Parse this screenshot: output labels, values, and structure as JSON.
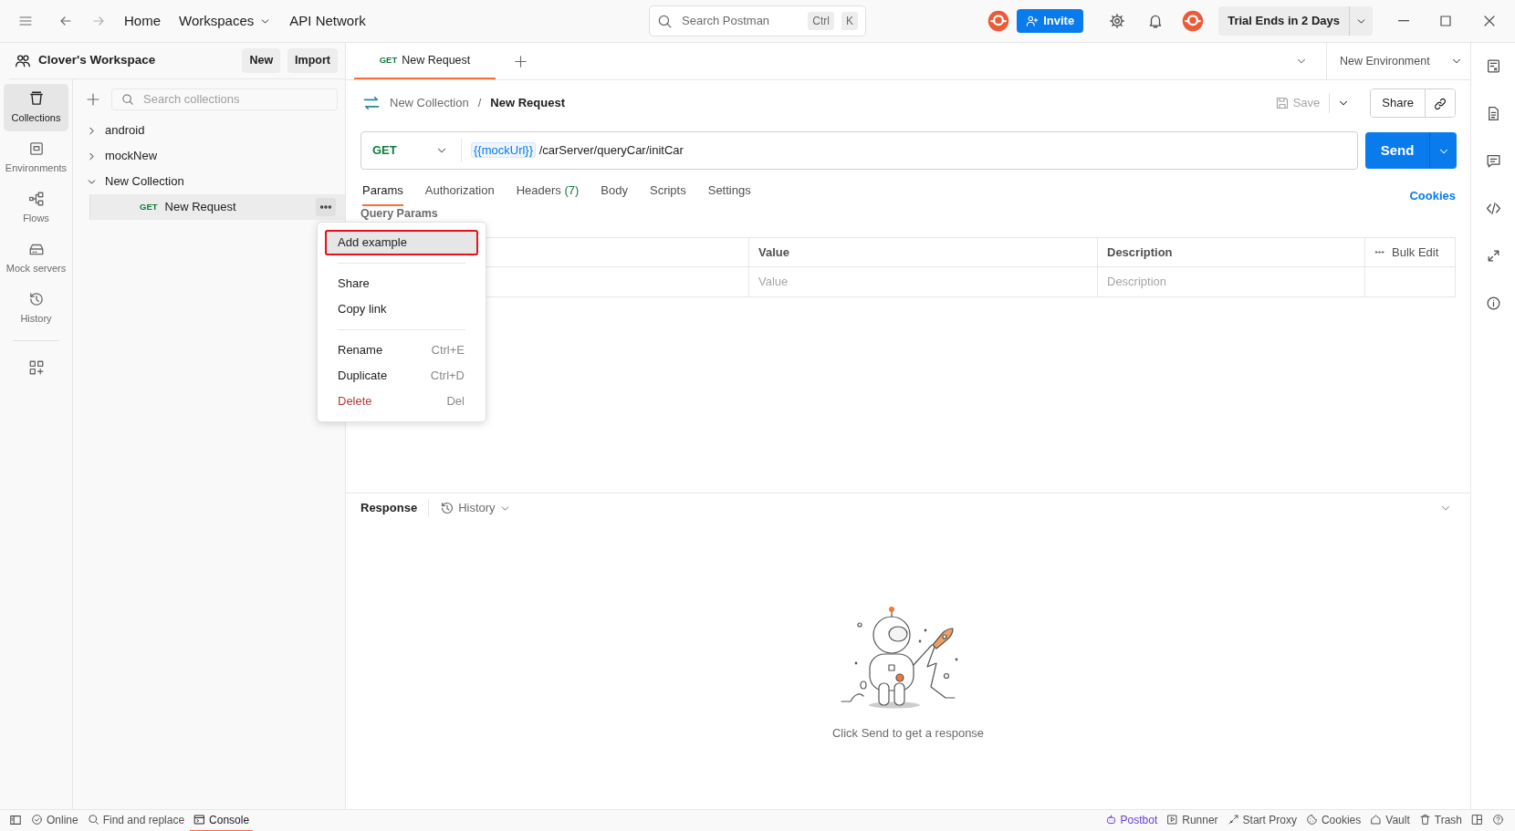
{
  "top_bar": {
    "nav": [
      {
        "label": "Home",
        "dropdown": false
      },
      {
        "label": "Workspaces",
        "dropdown": true
      },
      {
        "label": "API Network",
        "dropdown": false
      }
    ],
    "search": {
      "placeholder": "Search Postman",
      "keys": [
        "Ctrl",
        "K"
      ]
    },
    "invite": "Invite",
    "trial": "Trial Ends in 2 Days"
  },
  "workspace": {
    "name": "Clover's Workspace",
    "buttons": [
      "New",
      "Import"
    ]
  },
  "rail": [
    {
      "label": "Collections",
      "selected": true
    },
    {
      "label": "Environments",
      "selected": false
    },
    {
      "label": "Flows",
      "selected": false
    },
    {
      "label": "Mock servers",
      "selected": false
    },
    {
      "label": "History",
      "selected": false
    }
  ],
  "collections": {
    "search_placeholder": "Search collections",
    "tree": [
      {
        "label": "android",
        "expanded": false
      },
      {
        "label": "mockNew",
        "expanded": false
      },
      {
        "label": "New Collection",
        "expanded": true,
        "children": [
          {
            "method": "GET",
            "label": "New Request",
            "selected": true
          }
        ]
      }
    ]
  },
  "context_menu": {
    "groups": [
      [
        {
          "label": "Add example",
          "selected": true,
          "annotated": true,
          "kind": "normal"
        }
      ],
      [
        {
          "label": "Share",
          "selected": false,
          "annotated": false,
          "kind": "normal"
        },
        {
          "label": "Copy link",
          "selected": false,
          "annotated": false,
          "kind": "normal"
        }
      ],
      [
        {
          "label": "Rename",
          "shortcut": "Ctrl+E",
          "selected": false,
          "annotated": false,
          "kind": "normal"
        },
        {
          "label": "Duplicate",
          "shortcut": "Ctrl+D",
          "selected": false,
          "annotated": false,
          "kind": "normal"
        },
        {
          "label": "Delete",
          "shortcut": "Del",
          "selected": false,
          "annotated": false,
          "kind": "danger"
        }
      ]
    ]
  },
  "request_tabs": [
    {
      "method": "GET",
      "label": "New Request",
      "selected": true
    }
  ],
  "environment": "New Environment",
  "breadcrumb": [
    "New Collection",
    "New Request"
  ],
  "breadcrumb_separator": "/",
  "save": "Save",
  "share": "Share",
  "request": {
    "method": "GET",
    "variable": "{{mockUrl}}",
    "path": "/carServer/queryCar/initCar",
    "send": "Send"
  },
  "tabs": [
    {
      "label": "Params",
      "selected": true
    },
    {
      "label": "Authorization",
      "selected": false
    },
    {
      "label": "Headers",
      "count": "(7)",
      "selected": false
    },
    {
      "label": "Body",
      "selected": false
    },
    {
      "label": "Scripts",
      "selected": false
    },
    {
      "label": "Settings",
      "selected": false
    }
  ],
  "cookies": "Cookies",
  "params": {
    "title": "Query Params",
    "columns": [
      "Value",
      "Description"
    ],
    "bulk_edit": "Bulk Edit",
    "placeholders": [
      "Value",
      "Description"
    ]
  },
  "response": {
    "title": "Response",
    "history": "History",
    "empty": "Click Send to get a response"
  },
  "status_bar": {
    "left": [
      {
        "label": "Online",
        "selected": false
      },
      {
        "label": "Find and replace",
        "selected": false
      },
      {
        "label": "Console",
        "selected": true
      }
    ],
    "right": [
      {
        "label": "Postbot",
        "highlighted": true
      },
      {
        "label": "Runner",
        "highlighted": false
      },
      {
        "label": "Start Proxy",
        "highlighted": false
      },
      {
        "label": "Cookies",
        "highlighted": false
      },
      {
        "label": "Vault",
        "highlighted": false
      },
      {
        "label": "Trash",
        "highlighted": false
      }
    ]
  }
}
